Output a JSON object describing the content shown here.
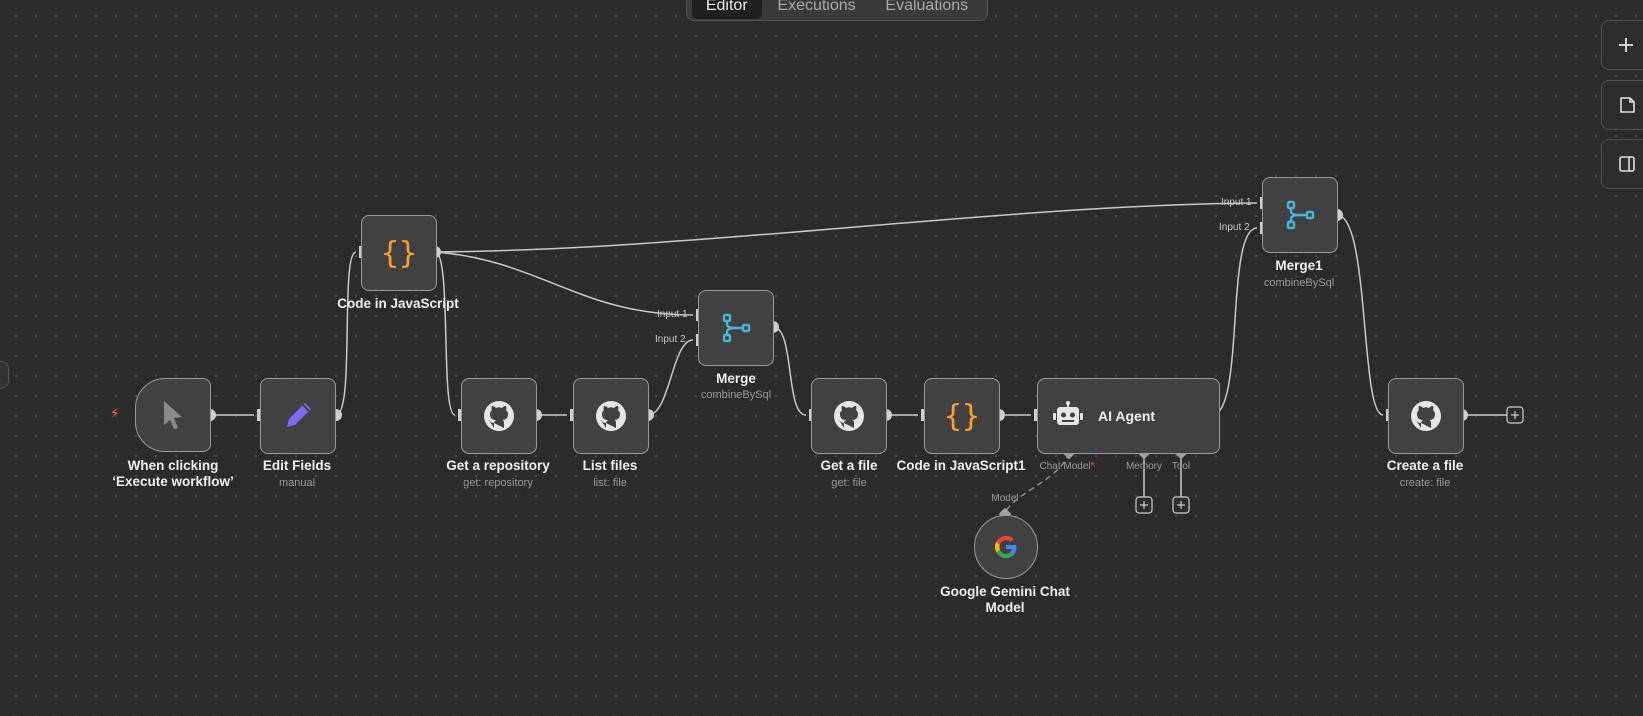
{
  "tabs": [
    "Editor",
    "Executions",
    "Evaluations"
  ],
  "trigger_bolt": "⚡",
  "nodes": {
    "trigger": {
      "title": "When clicking ‘Execute workflow’"
    },
    "edit_fields": {
      "title": "Edit Fields",
      "subtitle": "manual"
    },
    "code1": {
      "title": "Code in JavaScript"
    },
    "get_repo": {
      "title": "Get a repository",
      "subtitle": "get: repository"
    },
    "list_files": {
      "title": "List files",
      "subtitle": "list: file"
    },
    "merge": {
      "title": "Merge",
      "subtitle": "combineBySql",
      "input1": "Input 1",
      "input2": "Input 2"
    },
    "get_file": {
      "title": "Get a file",
      "subtitle": "get: file"
    },
    "code2": {
      "title": "Code in JavaScript1"
    },
    "agent": {
      "title": "AI Agent",
      "ports": {
        "chat_model": "Chat Model",
        "memory": "Memory",
        "tool": "Tool"
      }
    },
    "merge1": {
      "title": "Merge1",
      "subtitle": "combineBySql",
      "input1": "Input 1",
      "input2": "Input 2"
    },
    "create_file": {
      "title": "Create a file",
      "subtitle": "create: file"
    },
    "gemini": {
      "title": "Google Gemini Chat Model",
      "port": "Model"
    }
  },
  "icons": {
    "code": "{}",
    "colors": {
      "code": "#ff9c2a",
      "merge": "#45b5d8",
      "edit": "#7b6cf5",
      "trigger_bolt": "#ff5b5b"
    }
  }
}
